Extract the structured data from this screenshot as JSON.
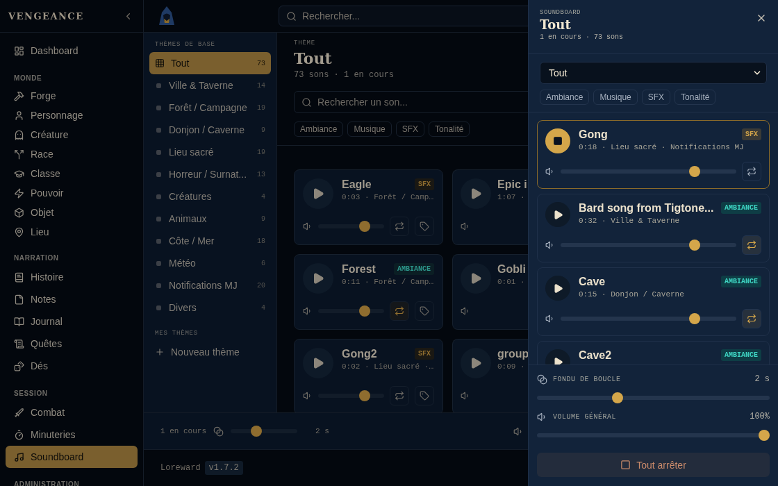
{
  "sidebar": {
    "brand": "VENGEANCE",
    "sections": [
      {
        "items": [
          {
            "label": "Dashboard",
            "selected": false
          }
        ]
      },
      {
        "title": "MONDE",
        "items": [
          {
            "label": "Forge",
            "selected": false
          },
          {
            "label": "Personnage",
            "selected": false
          },
          {
            "label": "Créature",
            "selected": false
          },
          {
            "label": "Race",
            "selected": false
          },
          {
            "label": "Classe",
            "selected": false
          },
          {
            "label": "Pouvoir",
            "selected": false
          },
          {
            "label": "Objet",
            "selected": false
          },
          {
            "label": "Lieu",
            "selected": false
          }
        ]
      },
      {
        "title": "NARRATION",
        "items": [
          {
            "label": "Histoire",
            "selected": false
          },
          {
            "label": "Notes",
            "selected": false
          },
          {
            "label": "Journal",
            "selected": false
          },
          {
            "label": "Quêtes",
            "selected": false
          },
          {
            "label": "Dés",
            "selected": false
          }
        ]
      },
      {
        "title": "SESSION",
        "items": [
          {
            "label": "Combat",
            "selected": false
          },
          {
            "label": "Minuteries",
            "selected": false
          },
          {
            "label": "Soundboard",
            "selected": true
          }
        ]
      },
      {
        "title": "ADMINISTRATION"
      }
    ]
  },
  "topbar": {
    "search": {
      "placeholder": "Rechercher..."
    }
  },
  "themes": {
    "base_title": "THÈMES DE BASE",
    "items": [
      {
        "label": "Tout",
        "count": "73",
        "selected": true
      },
      {
        "label": "Ville & Taverne",
        "count": "14",
        "selected": false
      },
      {
        "label": "Forêt / Campagne",
        "count": "19",
        "selected": false
      },
      {
        "label": "Donjon / Caverne",
        "count": "9",
        "selected": false
      },
      {
        "label": "Lieu sacré",
        "count": "19",
        "selected": false
      },
      {
        "label": "Horreur / Surnat...",
        "count": "13",
        "selected": false
      },
      {
        "label": "Créatures",
        "count": "4",
        "selected": false
      },
      {
        "label": "Animaux",
        "count": "9",
        "selected": false
      },
      {
        "label": "Côte / Mer",
        "count": "18",
        "selected": false
      },
      {
        "label": "Météo",
        "count": "6",
        "selected": false
      },
      {
        "label": "Notifications MJ",
        "count": "20",
        "selected": false
      },
      {
        "label": "Divers",
        "count": "4",
        "selected": false
      }
    ],
    "mine_title": "MES THÈMES",
    "new_label": "Nouveau thème"
  },
  "main": {
    "eyebrow": "THÈME",
    "title": "Tout",
    "subtitle": "73 sons · 1 en cours",
    "search": {
      "placeholder": "Rechercher un son..."
    },
    "chips": [
      "Ambiance",
      "Musique",
      "SFX",
      "Tonalité"
    ],
    "cards": [
      {
        "name": "Eagle",
        "meta": "0:03 · Forêt / Camp…",
        "tag": {
          "kind": "sfx",
          "text": "SFX"
        },
        "level": 0.75,
        "loop": false
      },
      {
        "name": "Epic i",
        "meta": "1:07 ·"
      },
      {
        "name": "Forest",
        "meta": "0:11 · Forêt / Camp…",
        "tag": {
          "kind": "ambiance",
          "text": "AMBIANCE"
        },
        "level": 0.75,
        "loop": true
      },
      {
        "name": "Gobli",
        "meta": "0:01 ·"
      },
      {
        "name": "Gong2",
        "meta": "0:02 · Lieu sacré ·…",
        "tag": {
          "kind": "sfx",
          "text": "SFX"
        },
        "level": 0.75,
        "loop": false
      },
      {
        "name": "group",
        "meta": "0:09 ·"
      }
    ]
  },
  "player_bar": {
    "playing": "1 en cours",
    "fade": {
      "level": 0.36,
      "value": "2 s"
    }
  },
  "footer": {
    "app": "Loreward",
    "version": "v1.7.2"
  },
  "drawer": {
    "eyebrow": "SOUNDBOARD",
    "title": "Tout",
    "subtitle": "1 en cours · 73 sons",
    "select": "Tout",
    "chips": [
      "Ambiance",
      "Musique",
      "SFX",
      "Tonalité"
    ],
    "sounds": [
      {
        "name": "Gong",
        "meta": "0:18 · Lieu sacré · Notifications MJ",
        "tag": {
          "kind": "sfx",
          "text": "SFX"
        },
        "playing": true,
        "level": 0.78,
        "loop": false
      },
      {
        "name": "Bard song from Tigtone...",
        "meta": "0:32 · Ville & Taverne",
        "tag": {
          "kind": "ambiance",
          "text": "AMBIANCE"
        },
        "playing": false,
        "level": 0.78,
        "loop": true
      },
      {
        "name": "Cave",
        "meta": "0:15 · Donjon / Caverne",
        "tag": {
          "kind": "ambiance",
          "text": "AMBIANCE"
        },
        "playing": false,
        "level": 0.78,
        "loop": true
      },
      {
        "name": "Cave2",
        "tag": {
          "kind": "ambiance",
          "text": "AMBIANCE"
        },
        "playing": false
      }
    ],
    "fade": {
      "label": "FONDU DE BOUCLE",
      "value": "2 s",
      "level": 0.34
    },
    "volume": {
      "label": "VOLUME GÉNÉRAL",
      "value": "100%",
      "level": 1
    },
    "stop_label": "Tout arrêter"
  }
}
